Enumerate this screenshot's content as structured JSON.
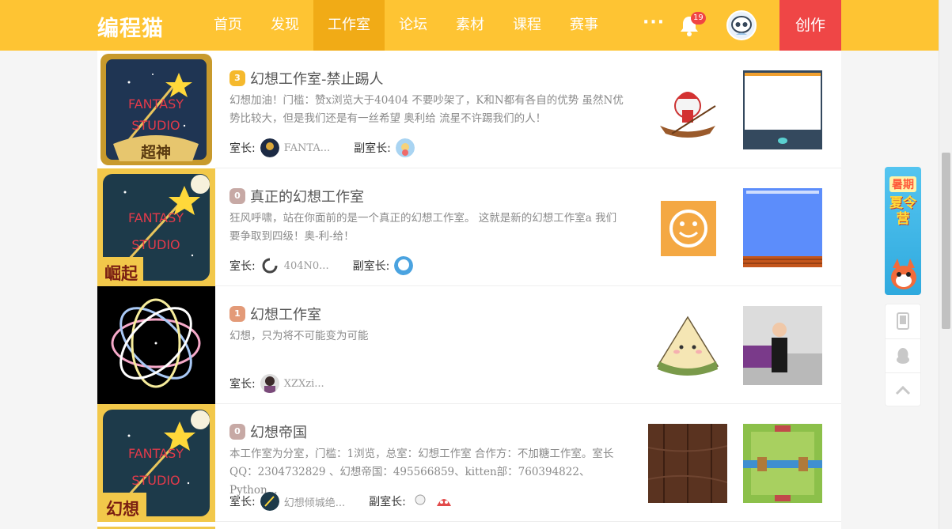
{
  "header": {
    "logo": "编程猫",
    "nav": [
      "首页",
      "发现",
      "工作室",
      "论坛",
      "素材",
      "课程",
      "赛事"
    ],
    "more": "···",
    "notification_count": "19",
    "create_label": "创作"
  },
  "studios": [
    {
      "level": "3",
      "title": "幻想工作室-禁止踢人",
      "desc": "幻想加油！门槛：赞x浏览大于40404 不要吵架了，K和N都有各自的优势 虽然N优势比较大，但是我们还是有一丝希望 奥利给 流星不许踢我们的人！",
      "owner_label": "室长:",
      "owner_name": "FANTA...",
      "deputy_label": "副室长:",
      "cover_tag": "超神",
      "cover_text": [
        "FANTASY",
        "STUDIO"
      ]
    },
    {
      "level": "0",
      "title": "真正的幻想工作室",
      "desc": "狂风呼啸，站在你面前的是一个真正的幻想工作室。 这就是新的幻想工作室a 我们要争取到四级！奥-利-给！",
      "owner_label": "室长:",
      "owner_name": "404N0...",
      "deputy_label": "副室长:",
      "cover_tag": "崛起",
      "cover_text": [
        "FANTASY",
        "STUDIO"
      ]
    },
    {
      "level": "1",
      "title": "幻想工作室",
      "desc": "幻想，只为将不可能变为可能",
      "owner_label": "室长:",
      "owner_name": "XZXzi..."
    },
    {
      "level": "0",
      "title": "幻想帝国",
      "desc": "本工作室为分室，门槛：1浏览，总室：幻想工作室 合作方：不加糖工作室。室长QQ：2304732829 、幻想帝国：495566859、kitten部：760394822、Python...",
      "owner_label": "室长:",
      "owner_name": "幻想倾城绝...",
      "deputy_label": "副室长:",
      "cover_tag": "幻想",
      "cover_text": [
        "FANTASY",
        "STUDIO"
      ]
    }
  ],
  "promo": {
    "line1": "暑期",
    "line2": "夏令营"
  },
  "colors": {
    "header": "#fec433",
    "active_nav": "#f1ab16",
    "create": "#ef4646",
    "level_gold": "#f5b92d",
    "level_gray": "#c7a9a5",
    "level_bronze": "#e39a78"
  },
  "icons": [
    "bell-icon",
    "phone-icon",
    "qq-penguin-icon",
    "back-to-top-icon"
  ]
}
